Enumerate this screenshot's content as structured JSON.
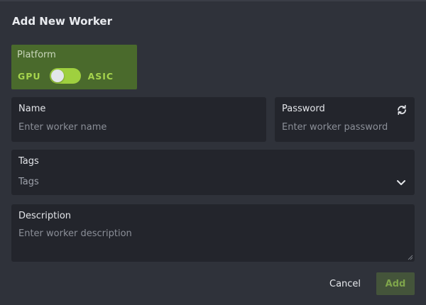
{
  "dialog": {
    "title": "Add New Worker"
  },
  "platform": {
    "label": "Platform",
    "option_left": "GPU",
    "option_right": "ASIC",
    "selected": "GPU"
  },
  "fields": {
    "name": {
      "label": "Name",
      "placeholder": "Enter worker name",
      "value": ""
    },
    "password": {
      "label": "Password",
      "placeholder": "Enter worker password",
      "value": "",
      "icon": "refresh-icon"
    },
    "tags": {
      "label": "Tags",
      "selected_text": "Tags",
      "icon": "chevron-down-icon"
    },
    "description": {
      "label": "Description",
      "placeholder": "Enter worker description",
      "value": ""
    }
  },
  "actions": {
    "cancel_label": "Cancel",
    "add_label": "Add"
  },
  "colors": {
    "background": "#2f323a",
    "field_background": "#23252c",
    "accent": "#9fd03f",
    "platform_background": "#4a6a2c"
  }
}
